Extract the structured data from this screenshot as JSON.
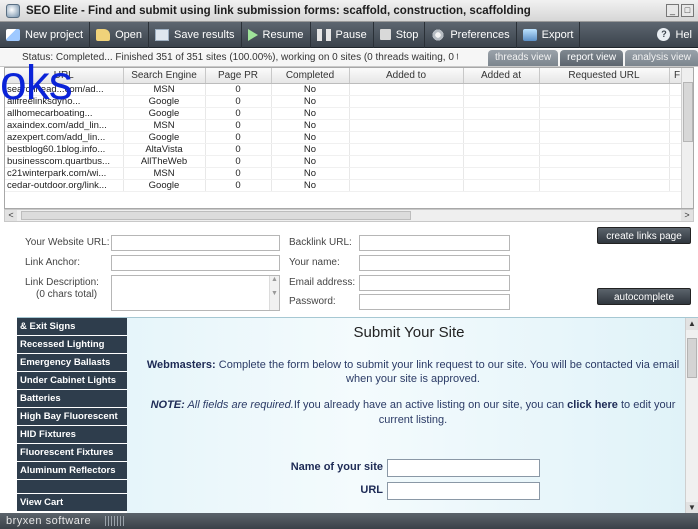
{
  "window": {
    "title": "SEO Elite - Find and submit using link submission forms: scaffold, construction, scaffolding"
  },
  "toolbar": {
    "new_project": "New project",
    "open": "Open",
    "save_results": "Save results",
    "resume": "Resume",
    "pause": "Pause",
    "stop": "Stop",
    "preferences": "Preferences",
    "export": "Export",
    "help": "Hel"
  },
  "status": {
    "text": "Status: Completed... Finished 351 of 351 sites (100.00%), working on 0 sites (0 threads waiting, 0 thread...",
    "tabs": [
      "threads view",
      "report view",
      "analysis view"
    ]
  },
  "overlay": {
    "logo_text": "oks"
  },
  "grid": {
    "columns": [
      "URL",
      "Search Engine",
      "Page PR",
      "Completed",
      "Added to",
      "Added at",
      "Requested URL",
      "F"
    ],
    "rows": [
      [
        "searchhead...com/ad...",
        "MSN",
        "0",
        "No",
        "",
        "",
        "",
        ""
      ],
      [
        "allfreelinksdyno...",
        "Google",
        "0",
        "No",
        "",
        "",
        "",
        ""
      ],
      [
        "allhomecarboating...",
        "Google",
        "0",
        "No",
        "",
        "",
        "",
        ""
      ],
      [
        "axaindex.com/add_lin...",
        "MSN",
        "0",
        "No",
        "",
        "",
        "",
        ""
      ],
      [
        "azexpert.com/add_lin...",
        "Google",
        "0",
        "No",
        "",
        "",
        "",
        ""
      ],
      [
        "bestblog60.1blog.info...",
        "AltaVista",
        "0",
        "No",
        "",
        "",
        "",
        ""
      ],
      [
        "businesscom.quartbus...",
        "AllTheWeb",
        "0",
        "No",
        "",
        "",
        "",
        ""
      ],
      [
        "c21winterpark.com/wi...",
        "MSN",
        "0",
        "No",
        "",
        "",
        "",
        ""
      ],
      [
        "cedar-outdoor.org/link...",
        "Google",
        "0",
        "No",
        "",
        "",
        "",
        ""
      ]
    ]
  },
  "form": {
    "website_url_label": "Your Website URL:",
    "link_anchor_label": "Link Anchor:",
    "link_description_label": "Link Description:",
    "chars_total": "(0 chars total)",
    "backlink_url_label": "Backlink URL:",
    "your_name_label": "Your name:",
    "email_label": "Email address:",
    "password_label": "Password:",
    "create_links_button": "create links page",
    "autocomplete_button": "autocomplete"
  },
  "browser": {
    "nav_items": [
      "& Exit Signs",
      "Recessed Lighting",
      "Emergency Ballasts",
      "Under Cabinet Lights",
      "Batteries",
      "High Bay Fluorescent",
      "HID Fixtures",
      "Fluorescent Fixtures",
      "Aluminum Reflectors",
      "",
      "View Cart"
    ],
    "heading": "Submit Your Site",
    "webmasters_label": "Webmasters:",
    "webmasters_text": " Complete the form below to submit your link request to our site. You will be contacted via email when your site is approved.",
    "note_label": "NOTE:",
    "note_italic": " All fields are required.",
    "note_text": "If you already have an active listing on our site, you can ",
    "click_here": "click here",
    "note_tail": " to edit your current listing.",
    "site_name_label": "Name of your site",
    "url_label": "URL"
  },
  "footer": {
    "brand": "bryxen software"
  }
}
